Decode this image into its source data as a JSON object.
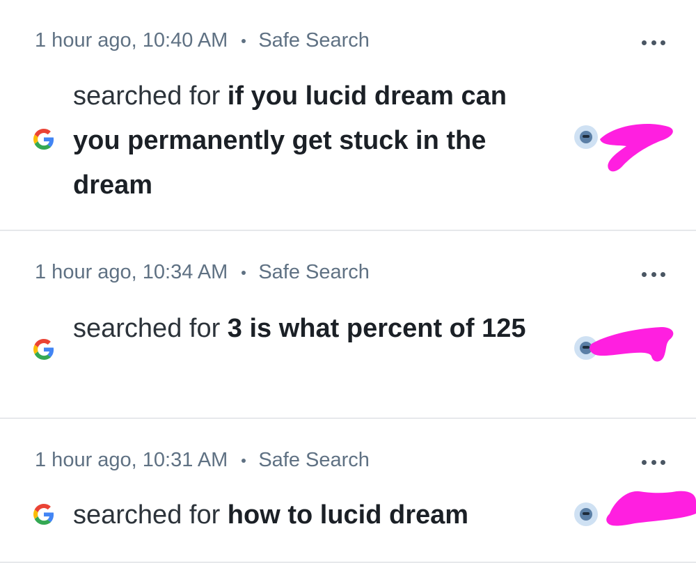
{
  "entries": [
    {
      "time": "1 hour ago, 10:40 AM",
      "mode": "Safe Search",
      "lead": "searched for ",
      "query": "if you lucid dream can you permanently get stuck in the dream",
      "icon": "google-g-icon",
      "avatar": "user-avatar-icon"
    },
    {
      "time": "1 hour ago, 10:34 AM",
      "mode": "Safe Search",
      "lead": "searched for ",
      "query": "3 is what percent of 125",
      "icon": "google-g-icon",
      "avatar": "user-avatar-icon"
    },
    {
      "time": "1 hour ago, 10:31 AM",
      "mode": "Safe Search",
      "lead": "searched for ",
      "query": "how to lucid dream",
      "icon": "google-g-icon",
      "avatar": "user-avatar-icon"
    }
  ],
  "colors": {
    "meta_text": "#5f7183",
    "divider": "#e6e8eb",
    "redaction": "#ff1fe0"
  }
}
